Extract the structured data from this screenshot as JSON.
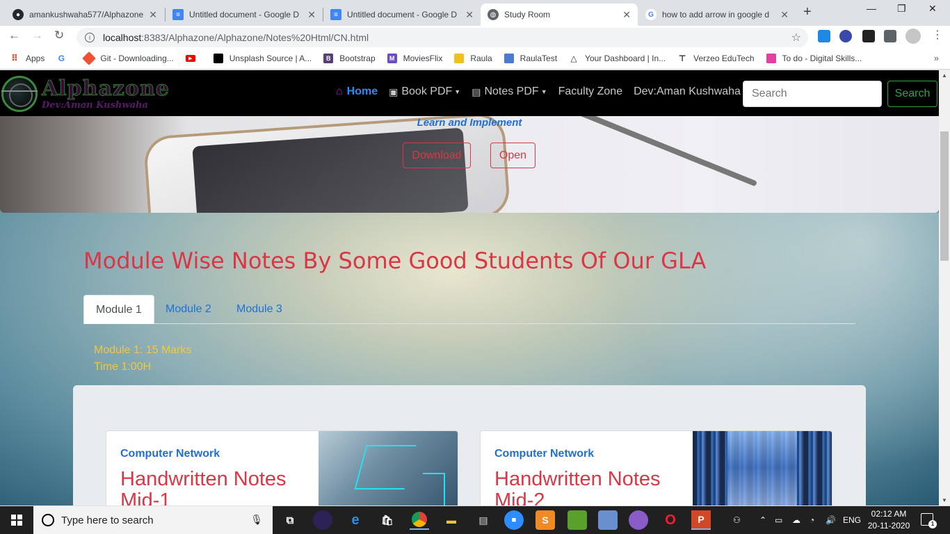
{
  "browser": {
    "tabs": [
      {
        "label": "amankushwaha577/Alphazone",
        "icon": "github-icon",
        "active": false
      },
      {
        "label": "Untitled document - Google D",
        "icon": "google-docs-icon",
        "active": false
      },
      {
        "label": "Untitled document - Google D",
        "icon": "google-docs-icon",
        "active": false
      },
      {
        "label": "Study Room",
        "icon": "globe-icon",
        "active": true
      },
      {
        "label": "how to add arrow in google d",
        "icon": "google-icon",
        "active": false
      }
    ],
    "url_host": "localhost",
    "url_rest": ":8383/Alphazone/Alphazone/Notes%20Html/CN.html",
    "bookmarks": [
      {
        "label": "Apps",
        "icon": "apps-grid-icon",
        "color": "#ea4335"
      },
      {
        "label": "",
        "icon": "google-icon",
        "color": "#4285f4"
      },
      {
        "label": "Git - Downloading...",
        "icon": "git-icon",
        "color": "#f05133"
      },
      {
        "label": "",
        "icon": "youtube-icon",
        "color": "#ff0000"
      },
      {
        "label": "Unsplash Source | A...",
        "icon": "unsplash-icon",
        "color": "#000000"
      },
      {
        "label": "Bootstrap",
        "icon": "bootstrap-icon",
        "color": "#563d7c"
      },
      {
        "label": "MoviesFlix",
        "icon": "moviesflix-icon",
        "color": "#6a4bc8"
      },
      {
        "label": "Raula",
        "icon": "raula-icon",
        "color": "#f0c020"
      },
      {
        "label": "RaulaTest",
        "icon": "raulatest-icon",
        "color": "#4a7bd0"
      },
      {
        "label": "Your Dashboard | In...",
        "icon": "dashboard-icon",
        "color": "#333333"
      },
      {
        "label": "Verzeo EduTech",
        "icon": "verzeo-icon",
        "color": "#222222"
      },
      {
        "label": "To do - Digital Skills...",
        "icon": "todo-icon",
        "color": "#e040a0"
      }
    ]
  },
  "site": {
    "logo_name": "Alphazone",
    "logo_dev": "Dev:Aman Kushwaha",
    "nav": {
      "home": "Home",
      "book_pdf": "Book PDF",
      "notes_pdf": "Notes PDF",
      "faculty": "Faculty Zone",
      "dev": "Dev:Aman Kushwaha"
    },
    "search_placeholder": "Search",
    "search_button": "Search"
  },
  "hero": {
    "tagline": "Learn and Implement",
    "download": "Download",
    "open": "Open"
  },
  "section": {
    "title": "Module Wise Notes By Some Good Students Of Our GLA",
    "tabs": [
      "Module 1",
      "Module 2",
      "Module 3"
    ],
    "active_tab": 0,
    "marks": "Module 1: 15 Marks",
    "time": "Time 1:00H"
  },
  "cards": [
    {
      "category": "Computer Network",
      "title": "Handwritten Notes Mid-1"
    },
    {
      "category": "Computer Network",
      "title": "Handwritten Notes Mid-2"
    }
  ],
  "taskbar": {
    "search_text": "Type here to search",
    "lang": "ENG",
    "time": "02:12 AM",
    "date": "20-11-2020",
    "notifications": "1"
  },
  "colors": {
    "accent_red": "#dc3545",
    "accent_blue": "#1f6fd6",
    "search_green": "#28a745",
    "module_info": "#f5c542"
  }
}
